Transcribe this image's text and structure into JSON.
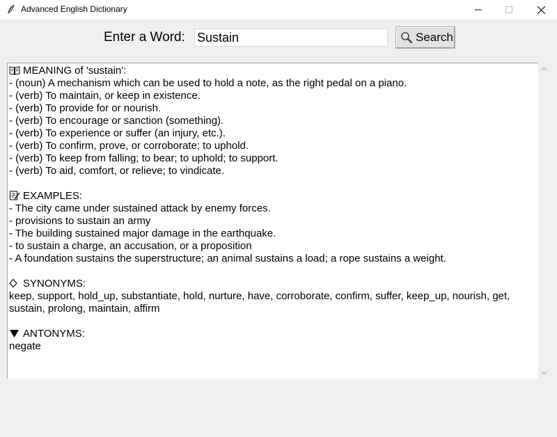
{
  "window": {
    "title": "Advanced English Dictionary",
    "app_icon": "feather-icon",
    "controls": [
      "minimize-icon",
      "maximize-icon",
      "close-icon"
    ]
  },
  "toolbar": {
    "label": "Enter a Word:",
    "input_value": "Sustain",
    "search_label": "Search",
    "search_icon": "magnifier-icon"
  },
  "result": {
    "meaning": {
      "icon": "book-icon",
      "heading": "MEANING of 'sustain':",
      "items": [
        "- (noun) A mechanism which can be used to hold a note, as the right pedal on a piano.",
        "- (verb) To maintain, or keep in existence.",
        "- (verb) To provide for or nourish.",
        "- (verb) To encourage or sanction (something).",
        "- (verb) To experience or suffer (an injury, etc.).",
        "- (verb) To confirm, prove, or corroborate; to uphold.",
        "- (verb) To keep from falling; to bear; to uphold; to support.",
        "- (verb) To aid, comfort, or relieve; to vindicate."
      ]
    },
    "examples": {
      "icon": "memo-icon",
      "heading": "EXAMPLES:",
      "items": [
        "- The city came under sustained attack by enemy forces.",
        "- provisions to sustain an army",
        "- The building sustained major damage in the earthquake.",
        "- to sustain a charge, an accusation, or a proposition",
        "- A foundation sustains the superstructure; an animal sustains a load; a rope sustains a weight."
      ]
    },
    "synonyms": {
      "icon": "diamond-icon",
      "heading": "SYNONYMS:",
      "text": "keep, support, hold_up, substantiate, hold, nurture, have, corroborate, confirm, suffer, keep_up, nourish, get, sustain, prolong, maintain, affirm"
    },
    "antonyms": {
      "icon": "triangle-down-icon",
      "heading": "ANTONYMS:",
      "text": "negate"
    }
  }
}
